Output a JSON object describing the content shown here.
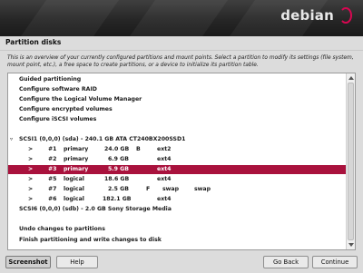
{
  "banner": {
    "logo_text": "debian"
  },
  "title": "Partition disks",
  "description": "This is an overview of your currently configured partitions and mount points. Select a partition to modify its settings (file system, mount point, etc.), a free space to create partitions, or a device to initialize its partition table.",
  "menu": {
    "guided": "Guided partitioning",
    "raid": "Configure software RAID",
    "lvm": "Configure the Logical Volume Manager",
    "encrypted": "Configure encrypted volumes",
    "iscsi": "Configure iSCSI volumes"
  },
  "disk1": {
    "toggle": "▿",
    "label": "SCSI1 (0,0,0) (sda) - 240.1 GB ATA CT240BX200SSD1"
  },
  "partitions": [
    {
      "arrow": ">",
      "num": "#1",
      "type": "primary",
      "size": "24.0 GB",
      "flag": "B",
      "fs": "ext2",
      "mount": ""
    },
    {
      "arrow": ">",
      "num": "#2",
      "type": "primary",
      "size": "6.9 GB",
      "flag": "",
      "fs": "ext4",
      "mount": ""
    },
    {
      "arrow": ">",
      "num": "#3",
      "type": "primary",
      "size": "5.9 GB",
      "flag": "",
      "fs": "ext4",
      "mount": ""
    },
    {
      "arrow": ">",
      "num": "#5",
      "type": "logical",
      "size": "18.6 GB",
      "flag": "",
      "fs": "ext4",
      "mount": ""
    },
    {
      "arrow": ">",
      "num": "#7",
      "type": "logical",
      "size": "2.5 GB",
      "flag": "F",
      "fs": "swap",
      "mount": "swap"
    },
    {
      "arrow": ">",
      "num": "#6",
      "type": "logical",
      "size": "182.1 GB",
      "flag": "",
      "fs": "ext4",
      "mount": ""
    }
  ],
  "disk2": {
    "label": "SCSI6 (0,0,0) (sdb) - 2.0 GB Sony Storage Media"
  },
  "actions": {
    "undo": "Undo changes to partitions",
    "finish": "Finish partitioning and write changes to disk"
  },
  "buttons": {
    "screenshot": "Screenshot",
    "help": "Help",
    "back": "Go Back",
    "continue": "Continue"
  },
  "colors": {
    "selection": "#a9123d",
    "accent": "#d70751"
  }
}
